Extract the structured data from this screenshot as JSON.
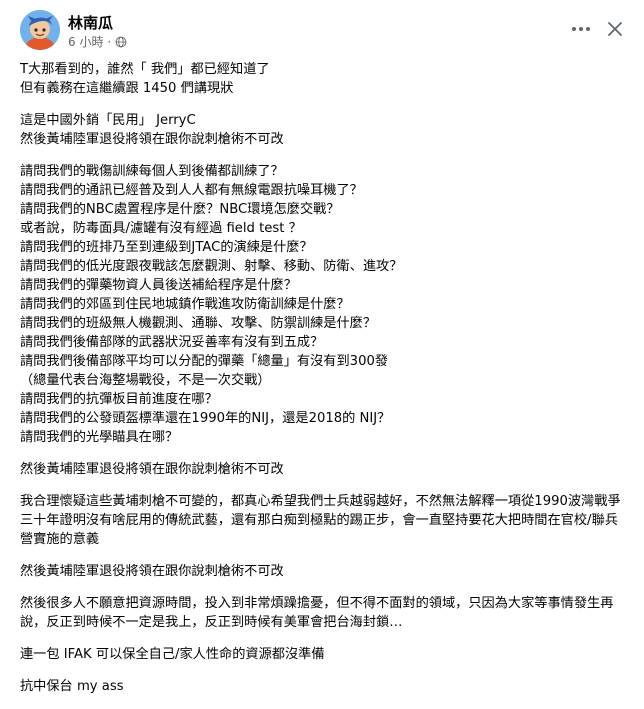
{
  "author": {
    "name": "林南瓜",
    "time": "6 小時",
    "separator": "·"
  },
  "post": {
    "paragraphs": [
      {
        "lines": [
          "T大那看到的，誰然「 我們」都已經知道了",
          "但有義務在這繼續跟 1450 們講現狀"
        ]
      },
      {
        "lines": [
          "這是中國外銷「民用」 JerryC",
          "然後黃埔陸軍退役將領在跟你說刺槍術不可改"
        ]
      },
      {
        "lines": [
          "請問我們的戰傷訓練每個人到後備都訓練了？",
          "請問我們的通訊已經普及到人人都有無線電跟抗噪耳機了？",
          "請問我們的NBC處置程序是什麼？NBC環境怎麼交戰？",
          "或者說，防毒面具/濾罐有沒有經過 field test ？",
          "請問我們的班排乃至到連級到JTAC的演練是什麼？",
          "請問我們的低光度跟夜戰該怎麼觀測、射擊、移動、防衛、進攻？",
          "請問我們的彈藥物資人員後送補給程序是什麼？",
          "請問我們的郊區到住民地城鎮作戰進攻防衛訓練是什麼？",
          "請問我們的班級無人機觀測、通聯、攻擊、防禦訓練是什麼？",
          "請問我們後備部隊的武器狀況妥善率有沒有到五成？",
          "請問我們後備部隊平均可以分配的彈藥「總量」有沒有到300發",
          "（總量代表台海整場戰役，不是一次交戰）",
          "請問我們的抗彈板目前進度在哪？",
          "請問我們的公發頭盔標準還在1990年的NIJ，還是2018的 NIJ？",
          "請問我們的光學瞄具在哪？"
        ]
      },
      {
        "lines": [
          "然後黃埔陸軍退役將領在跟你說刺槍術不可改"
        ]
      },
      {
        "wrap": true,
        "lines": [
          "我合理懷疑這些黃埔刺槍不可變的，都真心希望我們士兵越弱越好，不然無法解釋一項從1990波灣戰爭三十年證明沒有啥屁用的傳統武藝，還有那白痴到極點的踢正步，會一直堅持要花大把時間在官校/聯兵營實施的意義"
        ]
      },
      {
        "lines": [
          "然後黃埔陸軍退役將領在跟你說刺槍術不可改"
        ]
      },
      {
        "wrap": true,
        "lines": [
          "然後很多人不願意把資源時間，投入到非常煩躁擔憂，但不得不面對的領域，只因為大家等事情發生再說，反正到時候不一定是我上，反正到時候有美軍會把台海封鎖…"
        ]
      },
      {
        "lines": [
          "連一包 IFAK 可以保全自己/家人性命的資源都沒準備"
        ]
      },
      {
        "lines": [
          "抗中保台  my ass"
        ]
      }
    ]
  },
  "icons": {
    "avatar": "avatar-image",
    "globe": "globe-icon",
    "more": "more-options-icon",
    "close": "close-icon"
  },
  "colors": {
    "text": "#050505",
    "meta": "#65676b",
    "background": "#ffffff"
  }
}
